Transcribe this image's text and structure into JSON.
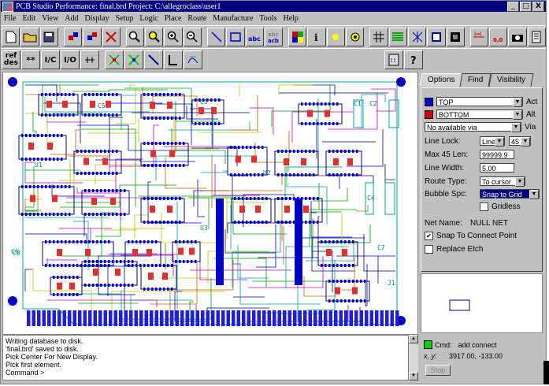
{
  "window": {
    "title": "PCB Studio Performance: final.brd  Project: C:\\allegroclass\\user1",
    "minimize": "_",
    "maximize": "□",
    "close": "X"
  },
  "menu": [
    "File",
    "Edit",
    "View",
    "Add",
    "Display",
    "Setup",
    "Logic",
    "Place",
    "Route",
    "Manufacture",
    "Tools",
    "Help"
  ],
  "toolbar2_labels": {
    "refdes_top": "ref",
    "refdes_bottom": "des",
    "stars": "**",
    "ic": "I/C",
    "io": "I/O"
  },
  "options_panel": {
    "tabs": [
      "Options",
      "Find",
      "Visibility"
    ],
    "active_layer": {
      "value": "TOP",
      "label": "Act",
      "color": "#0000cc"
    },
    "alt_layer": {
      "value": "BOTTOM",
      "label": "Alt",
      "color": "#cc0000"
    },
    "via": {
      "value": "No available via",
      "label": "Via"
    },
    "line_lock": {
      "label": "Line Lock:",
      "mode": "Line",
      "angle": "45"
    },
    "max45": {
      "label": "Max 45 Len:",
      "value": "99999.9"
    },
    "line_width": {
      "label": "Line Width:",
      "value": "5.00"
    },
    "route_type": {
      "label": "Route Type:",
      "value": "To cursor"
    },
    "bubble": {
      "label": "Bubble Spc:",
      "value": "Snap to Grid"
    },
    "gridless": "Gridless",
    "net_name": {
      "label": "Net Name:",
      "value": "NULL NET"
    },
    "snap_connect": "Snap To Connect Point",
    "replace_etch": "Replace Etch"
  },
  "console": {
    "lines": [
      "Writing database to disk.",
      "'final.brd' saved to disk.",
      "Pick Center For New Display.",
      "Pick first element.",
      "Command >"
    ]
  },
  "status": {
    "cmd_label": "Cmd:",
    "cmd_value": "add connect",
    "xy_label": "x, y:",
    "xy_value": "3917.00, -133.00",
    "stop": "Stop"
  },
  "board_labels": [
    "C1",
    "C2",
    "C3",
    "C4",
    "C5",
    "C6",
    "C7",
    "C8",
    "U1",
    "U2",
    "U3",
    "J1"
  ]
}
